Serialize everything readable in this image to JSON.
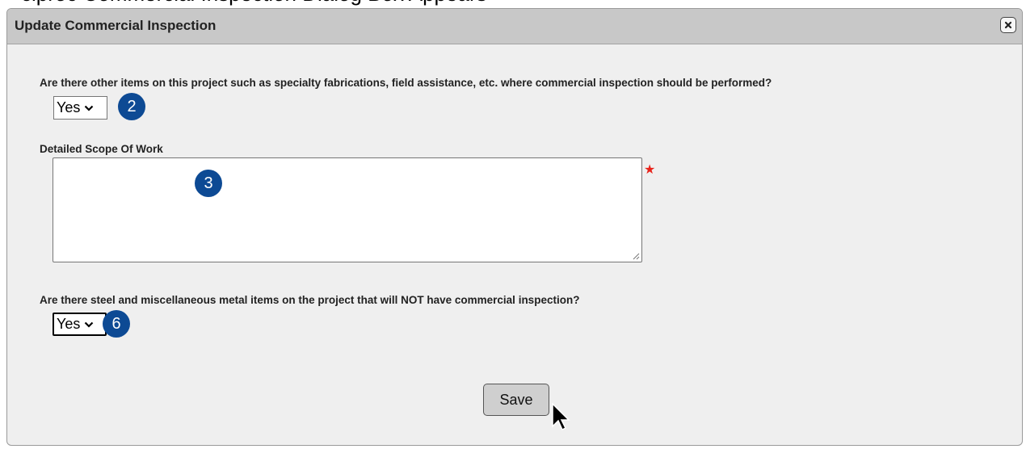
{
  "background_text": "ciproc Commercial Inspection Dialog Box Appears",
  "dialog": {
    "title": "Update Commercial Inspection"
  },
  "form": {
    "question1": "Are there other items on this project such as specialty fabrications, field assistance, etc. where commercial inspection should be performed?",
    "question1_value": "Yes",
    "scope_label": "Detailed Scope Of Work",
    "scope_value": "",
    "required_marker": "★",
    "question2": "Are there steel and miscellaneous metal items on the project that will NOT have commercial inspection?",
    "question2_value": "Yes",
    "save_label": "Save"
  },
  "callouts": {
    "step_2": "2",
    "step_3": "3",
    "step_6": "6"
  },
  "colors": {
    "badge": "#0d4a94",
    "required": "#e8231a",
    "titlebar": "#c8c8c8",
    "dialog_bg": "#efefef"
  },
  "icons": {
    "close": "close-icon",
    "dropdown": "chevron-down-icon",
    "cursor": "mouse-pointer-icon",
    "resize": "resize-grip-icon"
  }
}
